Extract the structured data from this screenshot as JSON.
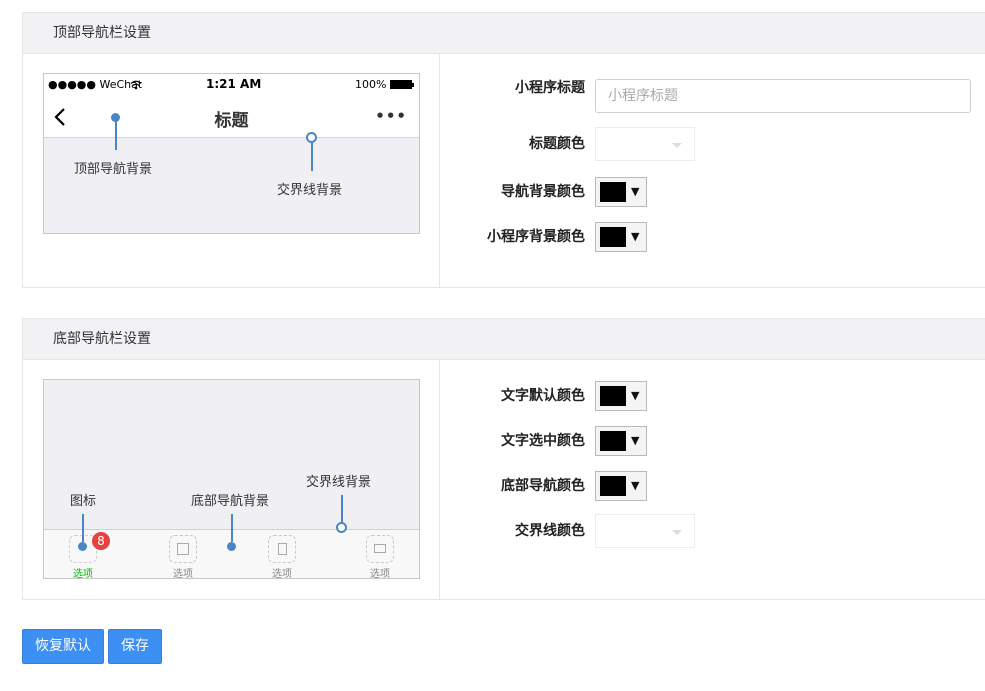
{
  "top_section": {
    "title": "顶部导航栏设置",
    "phone": {
      "status_left": "●●●●● WeChat",
      "status_time": "1:21 AM",
      "status_battery": "100%",
      "nav_title": "标题",
      "nav_more": "•••",
      "ann_nav_bg": "顶部导航背景",
      "ann_divider_bg": "交界线背景"
    },
    "fields": {
      "mp_title_label": "小程序标题",
      "mp_title_placeholder": "小程序标题",
      "title_color_label": "标题颜色",
      "nav_bg_color_label": "导航背景颜色",
      "mp_bg_color_label": "小程序背景颜色"
    }
  },
  "bottom_section": {
    "title": "底部导航栏设置",
    "phone": {
      "ann_icon": "图标",
      "ann_tab_bg": "底部导航背景",
      "ann_divider_bg": "交界线背景",
      "badge": "8",
      "tabs": [
        "选项",
        "选项",
        "选项",
        "选项"
      ]
    },
    "fields": {
      "text_default_color_label": "文字默认颜色",
      "text_selected_color_label": "文字选中颜色",
      "tab_bg_color_label": "底部导航颜色",
      "divider_color_label": "交界线颜色"
    }
  },
  "buttons": {
    "restore": "恢复默认",
    "save": "保存"
  },
  "colors": {
    "primary": "#3c8ff3",
    "annotation": "#4a86c6",
    "tab_active": "#09bb07",
    "badge": "#e64340",
    "swatch": "#000000"
  }
}
